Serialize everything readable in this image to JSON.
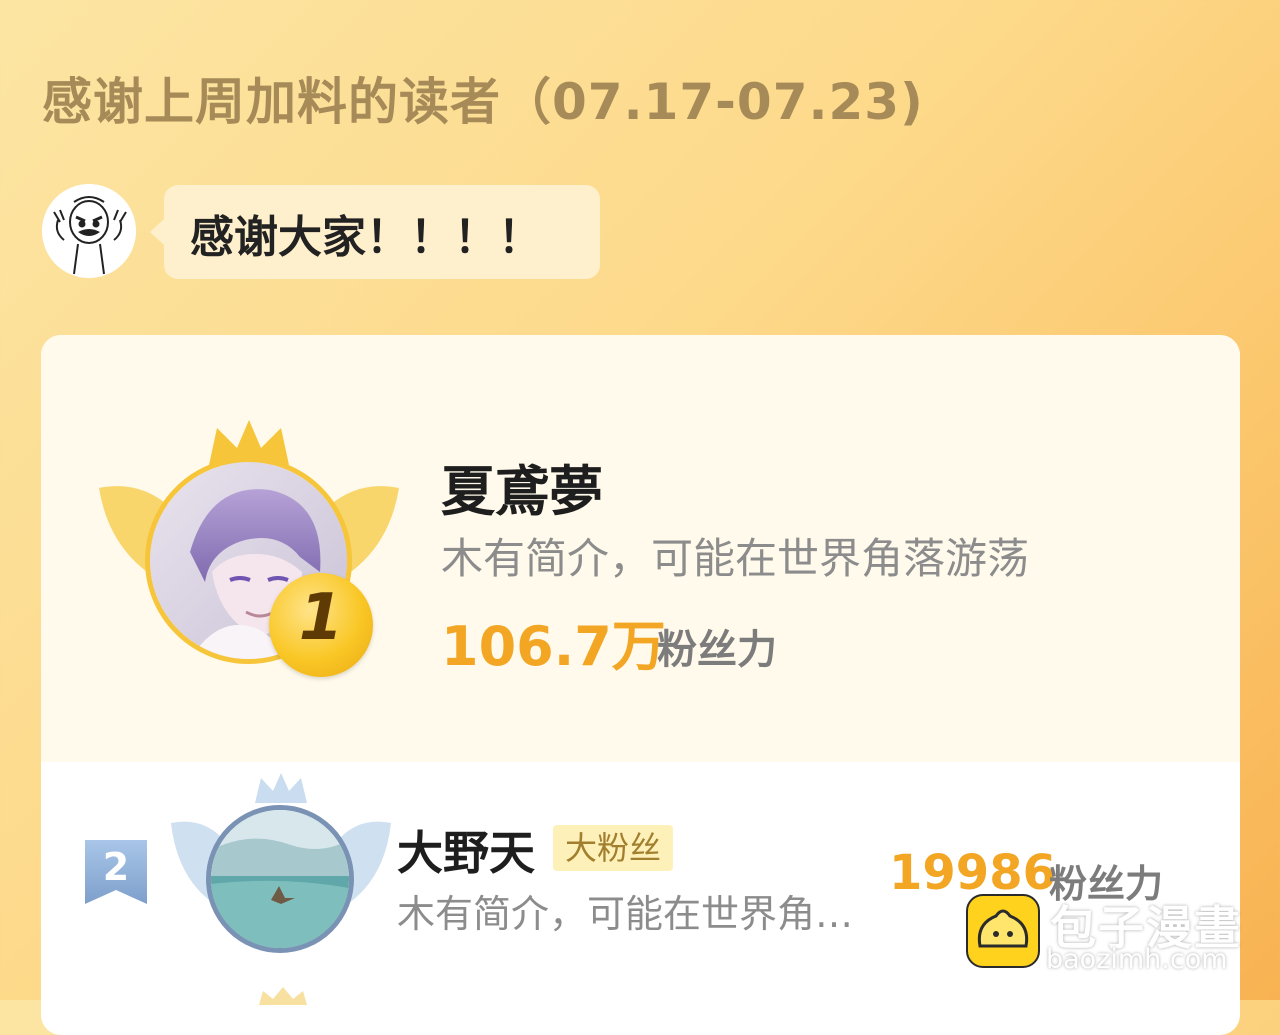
{
  "header": {
    "title": "感谢上周加料的读者（07.17-07.23)"
  },
  "message": {
    "text": "感谢大家！！！！"
  },
  "ranking": [
    {
      "rank": "1",
      "name": "夏鳶夢",
      "bio": "木有简介，可能在世界角落游荡",
      "fans_value": "106.7万",
      "fans_label": "粉丝力"
    },
    {
      "rank": "2",
      "name": "大野天",
      "tag": "大粉丝",
      "bio": "木有简介，可能在世界角落游荡",
      "fans_value": "19986",
      "fans_label": "粉丝力"
    }
  ],
  "colors": {
    "accent_gold": "#F2A623",
    "rank1_ring": "#F7C53A",
    "rank2_ring": "#7A92B3",
    "tag_bg": "#FDF0B8"
  },
  "icons": {
    "crown_gold": "crown-icon",
    "crown_silver": "crown-icon",
    "app_logo": "bun-logo-icon"
  },
  "watermark": {
    "title": "包子漫畫",
    "url": "baozimh.com"
  }
}
